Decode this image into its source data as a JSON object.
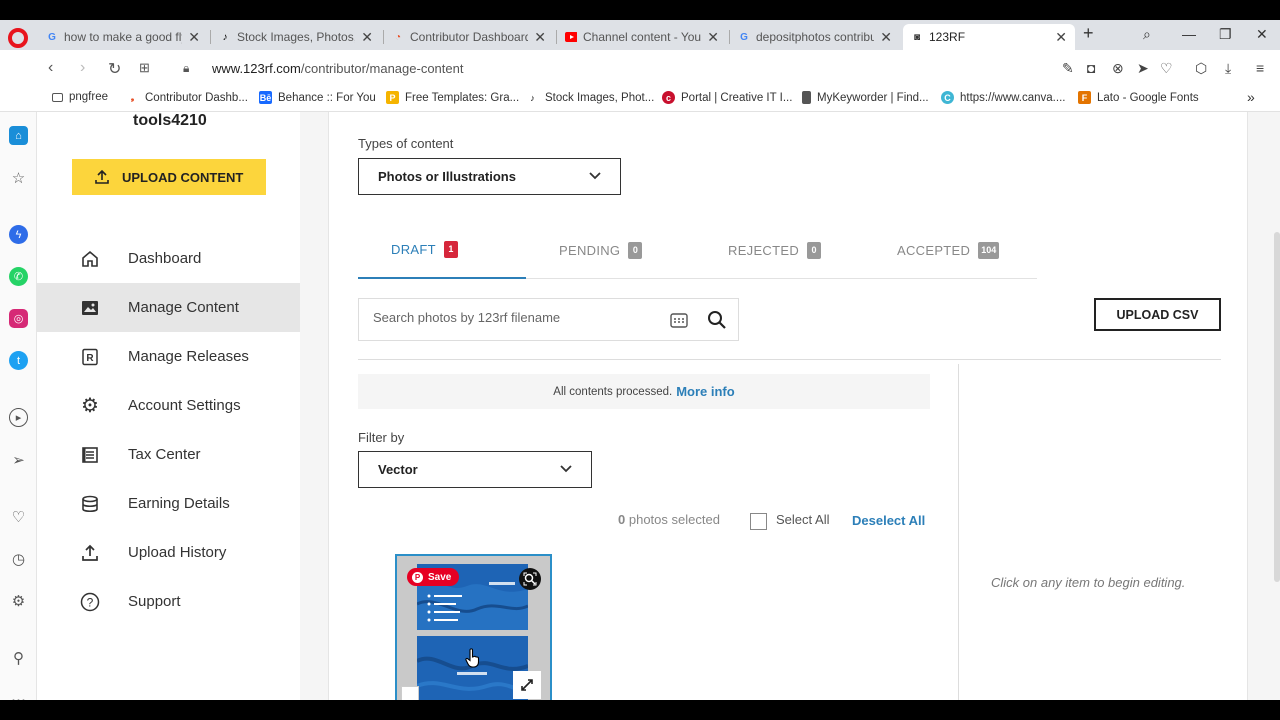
{
  "browser": {
    "tabs": [
      {
        "title": "how to make a good fly",
        "favicon": "google-icon"
      },
      {
        "title": "Stock Images, Photos, V",
        "favicon": "tiktok-icon"
      },
      {
        "title": "Contributor Dashboard",
        "favicon": "123rf-icon"
      },
      {
        "title": "Channel content - YouTu",
        "favicon": "youtube-icon"
      },
      {
        "title": "depositphotos contribut",
        "favicon": "google-icon"
      },
      {
        "title": "123RF",
        "favicon": "123rf-icon",
        "active": true
      }
    ],
    "url_host": "www.123rf.com",
    "url_path": "/contributor/manage-content",
    "bookmarks": [
      {
        "label": "pngfree",
        "icon": "folder-icon"
      },
      {
        "label": "Contributor Dashb...",
        "icon": "123rf-icon"
      },
      {
        "label": "Behance :: For You",
        "icon": "behance-icon"
      },
      {
        "label": "Free Templates: Gra...",
        "icon": "pikbest-icon"
      },
      {
        "label": "Stock Images, Phot...",
        "icon": "tiktok-icon"
      },
      {
        "label": "Portal | Creative IT I...",
        "icon": "creative-it-icon"
      },
      {
        "label": "MyKeyworder | Find...",
        "icon": "doc-icon"
      },
      {
        "label": "https://www.canva....",
        "icon": "canva-icon"
      },
      {
        "label": "Lato - Google Fonts",
        "icon": "google-fonts-icon"
      }
    ]
  },
  "sidebar": {
    "username": "tools4210",
    "upload_label": "UPLOAD CONTENT",
    "items": [
      {
        "label": "Dashboard",
        "icon": "home-icon"
      },
      {
        "label": "Manage Content",
        "icon": "image-icon",
        "selected": true
      },
      {
        "label": "Manage Releases",
        "icon": "release-icon"
      },
      {
        "label": "Account Settings",
        "icon": "gear-icon"
      },
      {
        "label": "Tax Center",
        "icon": "document-icon"
      },
      {
        "label": "Earning Details",
        "icon": "database-icon"
      },
      {
        "label": "Upload History",
        "icon": "upload-icon"
      },
      {
        "label": "Support",
        "icon": "help-icon"
      }
    ]
  },
  "main": {
    "types_label": "Types of content",
    "types_value": "Photos or Illustrations",
    "tabs": [
      {
        "label": "DRAFT",
        "count": "1"
      },
      {
        "label": "PENDING",
        "count": "0"
      },
      {
        "label": "REJECTED",
        "count": "0"
      },
      {
        "label": "ACCEPTED",
        "count": "104"
      }
    ],
    "search_placeholder": "Search photos by 123rf filename",
    "upload_csv": "UPLOAD CSV",
    "notice_text": "All contents processed.",
    "notice_link": "More info",
    "filter_label": "Filter by",
    "filter_value": "Vector",
    "selected_count": "0",
    "selected_text": "photos selected",
    "select_all": "Select All",
    "deselect_all": "Deselect All",
    "save_label": "Save",
    "editing_hint": "Click on any item to begin editing."
  },
  "colors": {
    "accent": "#2c7fb8",
    "upload_yellow": "#fcd53c",
    "badge_red": "#d6263b"
  }
}
